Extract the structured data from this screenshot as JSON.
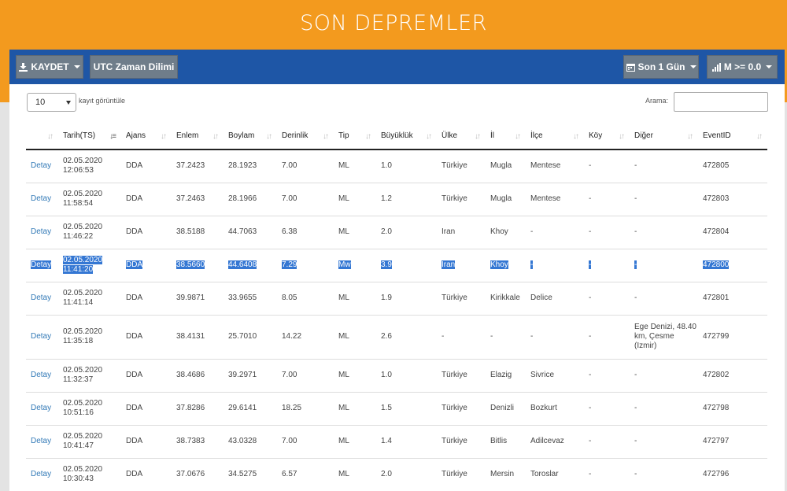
{
  "page": {
    "title": "SON DEPREMLER"
  },
  "toolbar": {
    "save_label": "KAYDET",
    "utc_label": "UTC Zaman Dilimi",
    "period_label": "Son 1 Gün",
    "magnitude_label": "M >= 0.0"
  },
  "controls": {
    "page_length": "10",
    "page_length_label": "kayıt görüntüle",
    "search_label": "Arama:",
    "search_value": ""
  },
  "table": {
    "headers": [
      "",
      "Tarih(TS)",
      "Ajans",
      "Enlem",
      "Boylam",
      "Derinlik",
      "Tip",
      "Büyüklük",
      "Ülke",
      "İl",
      "İlçe",
      "Köy",
      "Diğer",
      "EventID"
    ],
    "rows": [
      {
        "detail": "Detay",
        "date": "02.05.2020",
        "time": "12:06:53",
        "agency": "DDA",
        "lat": "37.2423",
        "lon": "28.1923",
        "depth": "7.00",
        "type": "ML",
        "mag": "1.0",
        "country": "Türkiye",
        "province": "Mugla",
        "district": "Mentese",
        "village": "-",
        "other": "-",
        "eventid": "472805"
      },
      {
        "detail": "Detay",
        "date": "02.05.2020",
        "time": "11:58:54",
        "agency": "DDA",
        "lat": "37.2463",
        "lon": "28.1966",
        "depth": "7.00",
        "type": "ML",
        "mag": "1.2",
        "country": "Türkiye",
        "province": "Mugla",
        "district": "Mentese",
        "village": "-",
        "other": "-",
        "eventid": "472803"
      },
      {
        "detail": "Detay",
        "date": "02.05.2020",
        "time": "11:46:22",
        "agency": "DDA",
        "lat": "38.5188",
        "lon": "44.7063",
        "depth": "6.38",
        "type": "ML",
        "mag": "2.0",
        "country": "Iran",
        "province": "Khoy",
        "district": "-",
        "village": "-",
        "other": "-",
        "eventid": "472804"
      },
      {
        "detail": "Detay",
        "date": "02.05.2020",
        "time": "11:41:20",
        "agency": "DDA",
        "lat": "38.5660",
        "lon": "44.6408",
        "depth": "7.29",
        "type": "Mw",
        "mag": "3.9",
        "country": "Iran",
        "province": "Khoy",
        "district": "-",
        "village": "-",
        "other": "-",
        "eventid": "472800"
      },
      {
        "detail": "Detay",
        "date": "02.05.2020",
        "time": "11:41:14",
        "agency": "DDA",
        "lat": "39.9871",
        "lon": "33.9655",
        "depth": "8.05",
        "type": "ML",
        "mag": "1.9",
        "country": "Türkiye",
        "province": "Kirikkale",
        "district": "Delice",
        "village": "-",
        "other": "-",
        "eventid": "472801"
      },
      {
        "detail": "Detay",
        "date": "02.05.2020",
        "time": "11:35:18",
        "agency": "DDA",
        "lat": "38.4131",
        "lon": "25.7010",
        "depth": "14.22",
        "type": "ML",
        "mag": "2.6",
        "country": "-",
        "province": "-",
        "district": "-",
        "village": "-",
        "other": "Ege Denizi, 48.40 km, Çesme (Izmir)",
        "eventid": "472799"
      },
      {
        "detail": "Detay",
        "date": "02.05.2020",
        "time": "11:32:37",
        "agency": "DDA",
        "lat": "38.4686",
        "lon": "39.2971",
        "depth": "7.00",
        "type": "ML",
        "mag": "1.0",
        "country": "Türkiye",
        "province": "Elazig",
        "district": "Sivrice",
        "village": "-",
        "other": "-",
        "eventid": "472802"
      },
      {
        "detail": "Detay",
        "date": "02.05.2020",
        "time": "10:51:16",
        "agency": "DDA",
        "lat": "37.8286",
        "lon": "29.6141",
        "depth": "18.25",
        "type": "ML",
        "mag": "1.5",
        "country": "Türkiye",
        "province": "Denizli",
        "district": "Bozkurt",
        "village": "-",
        "other": "-",
        "eventid": "472798"
      },
      {
        "detail": "Detay",
        "date": "02.05.2020",
        "time": "10:41:47",
        "agency": "DDA",
        "lat": "38.7383",
        "lon": "43.0328",
        "depth": "7.00",
        "type": "ML",
        "mag": "1.4",
        "country": "Türkiye",
        "province": "Bitlis",
        "district": "Adilcevaz",
        "village": "-",
        "other": "-",
        "eventid": "472797"
      },
      {
        "detail": "Detay",
        "date": "02.05.2020",
        "time": "10:30:43",
        "agency": "DDA",
        "lat": "37.0676",
        "lon": "34.5275",
        "depth": "6.57",
        "type": "ML",
        "mag": "2.0",
        "country": "Türkiye",
        "province": "Mersin",
        "district": "Toroslar",
        "village": "-",
        "other": "-",
        "eventid": "472796"
      }
    ],
    "selected_row": 3
  },
  "colors": {
    "header_orange": "#f39a1e",
    "toolbar_blue": "#1e56a6",
    "selection_blue": "#3477d3",
    "link_blue": "#337ab7"
  },
  "icons": {
    "save": "download-icon",
    "period": "calendar-icon",
    "magnitude": "signal-bars-icon",
    "sort": "sort-arrows-icon"
  }
}
